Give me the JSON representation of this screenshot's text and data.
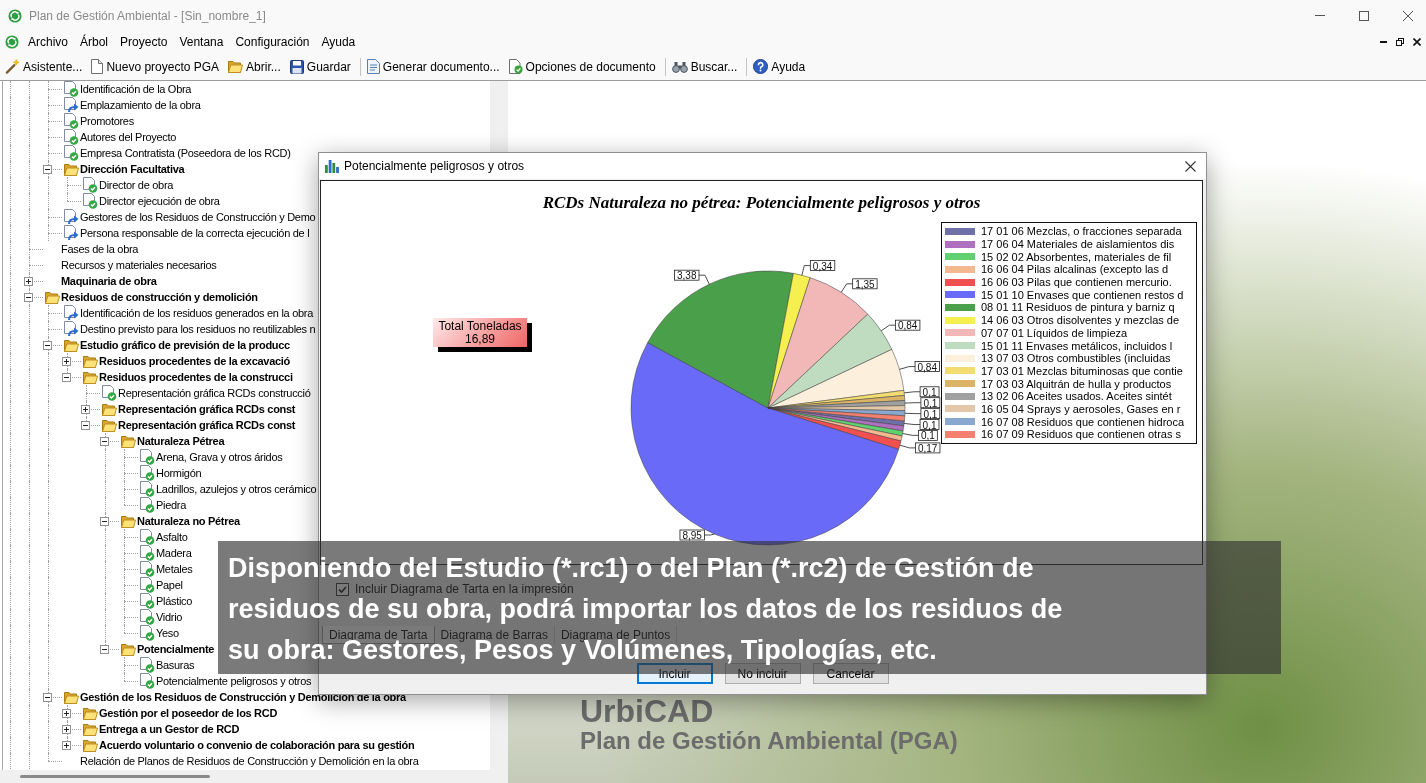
{
  "window": {
    "title": "Plan de Gestión Ambiental - [Sin_nombre_1]"
  },
  "menu": [
    "Archivo",
    "Árbol",
    "Proyecto",
    "Ventana",
    "Configuración",
    "Ayuda"
  ],
  "toolbar": [
    {
      "kind": "button",
      "label": "Asistente..."
    },
    {
      "kind": "button",
      "label": "Nuevo proyecto PGA"
    },
    {
      "kind": "button",
      "label": "Abrir..."
    },
    {
      "kind": "button",
      "label": "Guardar"
    },
    {
      "kind": "separator"
    },
    {
      "kind": "button",
      "label": "Generar documento..."
    },
    {
      "kind": "button",
      "label": "Opciones de documento"
    },
    {
      "kind": "separator"
    },
    {
      "kind": "button",
      "label": "Buscar..."
    },
    {
      "kind": "separator"
    },
    {
      "kind": "button",
      "label": "Ayuda"
    }
  ],
  "tree": {
    "items": [
      {
        "children": [
          {
            "children": [
              {
                "label": "Identificación de la Obra",
                "kind": "page",
                "complete": true
              },
              {
                "label": "Emplazamiento de la obra",
                "kind": "page",
                "complete": false
              },
              {
                "label": "Promotores",
                "kind": "page",
                "complete": true
              },
              {
                "label": "Autores del Proyecto",
                "kind": "page",
                "complete": true
              },
              {
                "label": "Empresa Contratista (Poseedora de los RCD)",
                "kind": "page",
                "complete": true
              },
              {
                "label": "Dirección Facultativa",
                "kind": "folder",
                "expanded": true,
                "children": [
                  {
                    "label": "Director de obra",
                    "kind": "page",
                    "complete": true
                  },
                  {
                    "label": "Director ejecución de obra",
                    "kind": "page",
                    "complete": true
                  }
                ]
              },
              {
                "label": "Gestores de los Residuos de Construcción y Demo",
                "kind": "page",
                "complete": false
              },
              {
                "label": "Persona responsable de la correcta ejecución de l",
                "kind": "page",
                "complete": false
              }
            ]
          },
          {
            "label": "Fases de la obra",
            "kind": "text"
          },
          {
            "label": "Recursos y materiales necesarios",
            "kind": "text"
          },
          {
            "label": "Maquinaria de obra",
            "kind": "text",
            "expanded": false
          },
          {
            "label": "Residuos de construcción y demolición",
            "kind": "folder",
            "expanded": true,
            "children": [
              {
                "label": "Identificación de los residuos generados en la obra",
                "kind": "page",
                "complete": false
              },
              {
                "label": "Destino previsto para los residuos no reutilizables n",
                "kind": "page",
                "complete": false
              },
              {
                "label": "Estudio gráfico de previsión de la producc",
                "kind": "folder",
                "expanded": true,
                "children": [
                  {
                    "label": "Residuos procedentes de la excavació",
                    "kind": "folder",
                    "expanded": false
                  },
                  {
                    "label": "Residuos procedentes de la construcci",
                    "kind": "folder",
                    "expanded": true,
                    "children": [
                      {
                        "label": "Representación gráfica RCDs construcció",
                        "kind": "page",
                        "complete": true
                      },
                      {
                        "label": "Representación gráfica RCDs const",
                        "kind": "folder",
                        "expanded": false
                      },
                      {
                        "label": "Representación gráfica RCDs const",
                        "kind": "folder",
                        "expanded": true,
                        "children": [
                          {
                            "label": "Naturaleza Pétrea",
                            "kind": "folder",
                            "expanded": true,
                            "children": [
                              {
                                "label": "Arena, Grava y otros áridos",
                                "kind": "page",
                                "complete": true
                              },
                              {
                                "label": "Hormigón",
                                "kind": "page",
                                "complete": true
                              },
                              {
                                "label": "Ladrillos, azulejos y otros cerámico",
                                "kind": "page",
                                "complete": true
                              },
                              {
                                "label": "Piedra",
                                "kind": "page",
                                "complete": true
                              }
                            ]
                          },
                          {
                            "label": "Naturaleza no Pétrea",
                            "kind": "folder",
                            "expanded": true,
                            "children": [
                              {
                                "label": "Asfalto",
                                "kind": "page",
                                "complete": true
                              },
                              {
                                "label": "Madera",
                                "kind": "page",
                                "complete": true
                              },
                              {
                                "label": "Metales",
                                "kind": "page",
                                "complete": true
                              },
                              {
                                "label": "Papel",
                                "kind": "page",
                                "complete": true
                              },
                              {
                                "label": "Plástico",
                                "kind": "page",
                                "complete": true
                              },
                              {
                                "label": "Vidrio",
                                "kind": "page",
                                "complete": true
                              },
                              {
                                "label": "Yeso",
                                "kind": "page",
                                "complete": true
                              }
                            ]
                          },
                          {
                            "label": "Potencialmente",
                            "kind": "folder",
                            "expanded": true,
                            "children": [
                              {
                                "label": "Basuras",
                                "kind": "page",
                                "complete": true
                              },
                              {
                                "label": "Potencialmente peligrosos y otros",
                                "kind": "page",
                                "complete": true
                              }
                            ]
                          }
                        ]
                      }
                    ]
                  }
                ]
              },
              {
                "label": "Gestión de los Residuos de Construcción y Demolición de la obra",
                "kind": "folder",
                "expanded": true,
                "children": [
                  {
                    "label": "Gestión por el poseedor de los RCD",
                    "kind": "folder",
                    "expanded": false
                  },
                  {
                    "label": "Entrega a un Gestor de RCD",
                    "kind": "folder",
                    "expanded": false
                  },
                  {
                    "label": "Acuerdo voluntario o convenio de colaboración para su gestión",
                    "kind": "folder",
                    "expanded": false
                  }
                ]
              },
              {
                "label": "Relación de Planos de Residuos de Construcción y Demolición en la obra",
                "kind": "text"
              }
            ]
          }
        ]
      }
    ]
  },
  "background": {
    "brand": "UrbiCAD",
    "subtitle": "Plan de Gestión Ambiental (PGA)"
  },
  "dialog": {
    "title": "Potencialmente peligrosos y otros",
    "chart_data": {
      "type": "pie",
      "title": "RCDs Naturaleza no pétrea: Potencialmente peligrosos y otros",
      "legend": "right",
      "categories": [
        "17 01 06 Mezclas, o fracciones separada",
        "17 06 04 Materiales de aislamientos dis",
        "15 02 02 Absorbentes, materiales de fil",
        "16 06 04 Pilas alcalinas (excepto las d",
        "16 06 03 Pilas que contienen mercurio.",
        "15 01 10 Envases que contienen restos d",
        "08 01 11 Residuos de pintura y barniz q",
        "14 06 03 Otros disolventes y mezclas de",
        "07 07 01 Líquidos de limpieza",
        "15 01 11 Envases metálicos, incluidos l",
        "13 07 03 Otros combustibles (incluidas",
        "17 03 01 Mezclas bituminosas que contie",
        "17 03 03 Alquitrán de hulla y productos",
        "13 02 06 Aceites usados. Aceites sintét",
        "16 05 04 Sprays y aerosoles, Gases en r",
        "16 07 08 Residuos que contienen hidroca",
        "16 07 09 Residuos que contienen otras s"
      ],
      "values": [
        0.1,
        0.1,
        0.1,
        0.1,
        0.17,
        8.95,
        3.38,
        0.34,
        1.35,
        0.84,
        0.84,
        0.1,
        0.1,
        0.1,
        0.1,
        0.1,
        0.1
      ],
      "colors": [
        "#7070a8",
        "#b070c0",
        "#60d070",
        "#f4b890",
        "#f05050",
        "#6a6af8",
        "#4aa04a",
        "#f5f050",
        "#f2b8b8",
        "#c0dcc0",
        "#fcefdc",
        "#f3dc70",
        "#dcb468",
        "#a0a0a0",
        "#e2c8a8",
        "#88a8d0",
        "#f48070"
      ],
      "value_labels": [
        "0,1",
        null,
        "0,1",
        null,
        "0,17",
        "8,95",
        "3,38",
        "0,34",
        "1,35",
        "0,84",
        "0,84",
        "0,1",
        null,
        "0,1",
        null,
        "0,1",
        null
      ]
    },
    "total": {
      "label": "Total Toneladas",
      "value": "16,89"
    },
    "print_option": {
      "label": "Incluir Diagrama de Tarta en la impresión",
      "checked": true
    },
    "tabs": [
      {
        "label": "Diagrama de Tarta",
        "selected": true
      },
      {
        "label": "Diagrama de Barras",
        "selected": false
      },
      {
        "label": "Diagrama de Puntos",
        "selected": false
      }
    ],
    "buttons": [
      {
        "label": "Incluir",
        "default": true
      },
      {
        "label": "No incluir",
        "default": false
      },
      {
        "label": "Cancelar",
        "default": false
      }
    ]
  },
  "caption": "Disponiendo del Estudio (*.rc1) o del Plan (*.rc2) de Gestión de\nresiduos de su obra, podrá importar los datos de los residuos de\nsu obra: Gestores, Pesos y Volúmenes, Tipologías, etc."
}
